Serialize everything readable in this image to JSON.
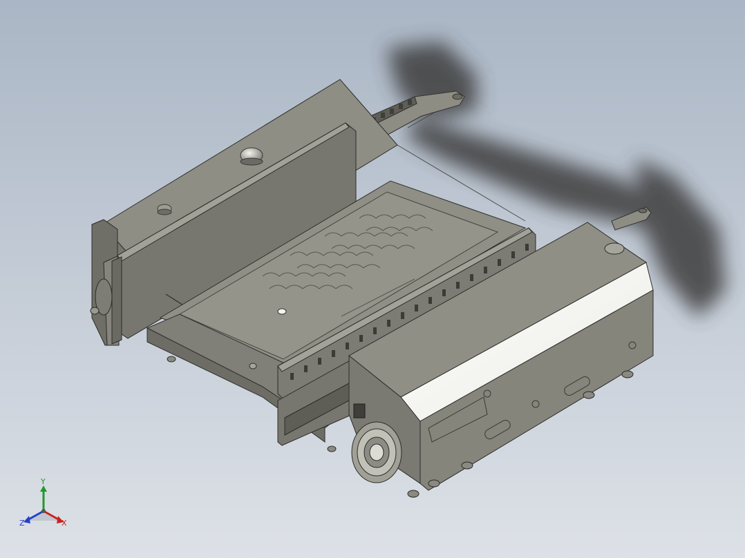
{
  "viewport": {
    "background_top": "#aab6c5",
    "background_bottom": "#dde1e7"
  },
  "model": {
    "body_color": "#8a8a80",
    "dark_color": "#6b6b63",
    "highlight_color": "#ffffff",
    "shadow_color": "#3c3c3c"
  },
  "triad": {
    "x_label": "X",
    "y_label": "Y",
    "z_label": "Z",
    "x_color": "#c8231f",
    "y_color": "#1f9a2a",
    "z_color": "#2341c8"
  }
}
